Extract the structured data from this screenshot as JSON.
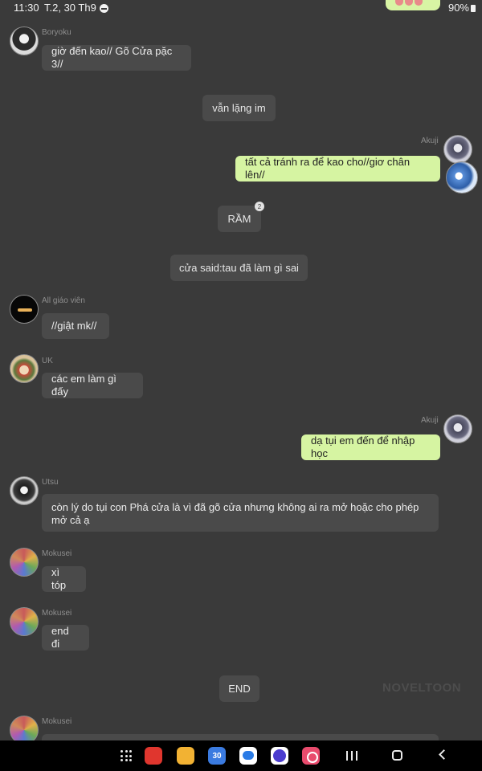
{
  "status_bar": {
    "time": "11:30",
    "date": "T.2, 30 Th9",
    "battery": "90%"
  },
  "messages": {
    "m1": {
      "sender": "Boryoku",
      "text": "giờ đến kao// Gõ Cửa pặc 3//"
    },
    "n1": {
      "text": "vẫn lặng im"
    },
    "m2": {
      "sender": "Akuji",
      "text": "tất cả tránh ra để kao cho//giơ chân lên//"
    },
    "n2": {
      "text": "RẦM",
      "badge": "2"
    },
    "n3": {
      "text": "cửa said:tau đã làm gì sai"
    },
    "m3": {
      "sender": "All giáo viên",
      "text": "//giật mk//"
    },
    "m4": {
      "sender": "UK",
      "text": "các em làm gì đấy"
    },
    "m5": {
      "sender": "Akuji",
      "text": "dạ tụi em đến để nhập học"
    },
    "m6": {
      "sender": "Utsu",
      "text": "còn lý do tụi con Phá cửa là vì đã gõ cửa nhưng không ai ra mở hoặc cho phép mở cả ạ"
    },
    "m7": {
      "sender": "Mokusei",
      "text": "xì tóp"
    },
    "m8": {
      "sender": "Mokusei",
      "text": "end đi"
    },
    "n4": {
      "text": "END"
    },
    "m9": {
      "sender": "Mokusei"
    }
  },
  "watermark": "NOVELTOON",
  "navbar": {
    "calendar_day": "30",
    "apps": [
      "flipboard-icon",
      "files-icon",
      "calendar-icon",
      "messages-icon",
      "internet-icon",
      "camera-icon"
    ]
  },
  "colors": {
    "background": "#3a3a3a",
    "bubble_other": "#4a4a4a",
    "bubble_me": "#d6f4a2"
  }
}
